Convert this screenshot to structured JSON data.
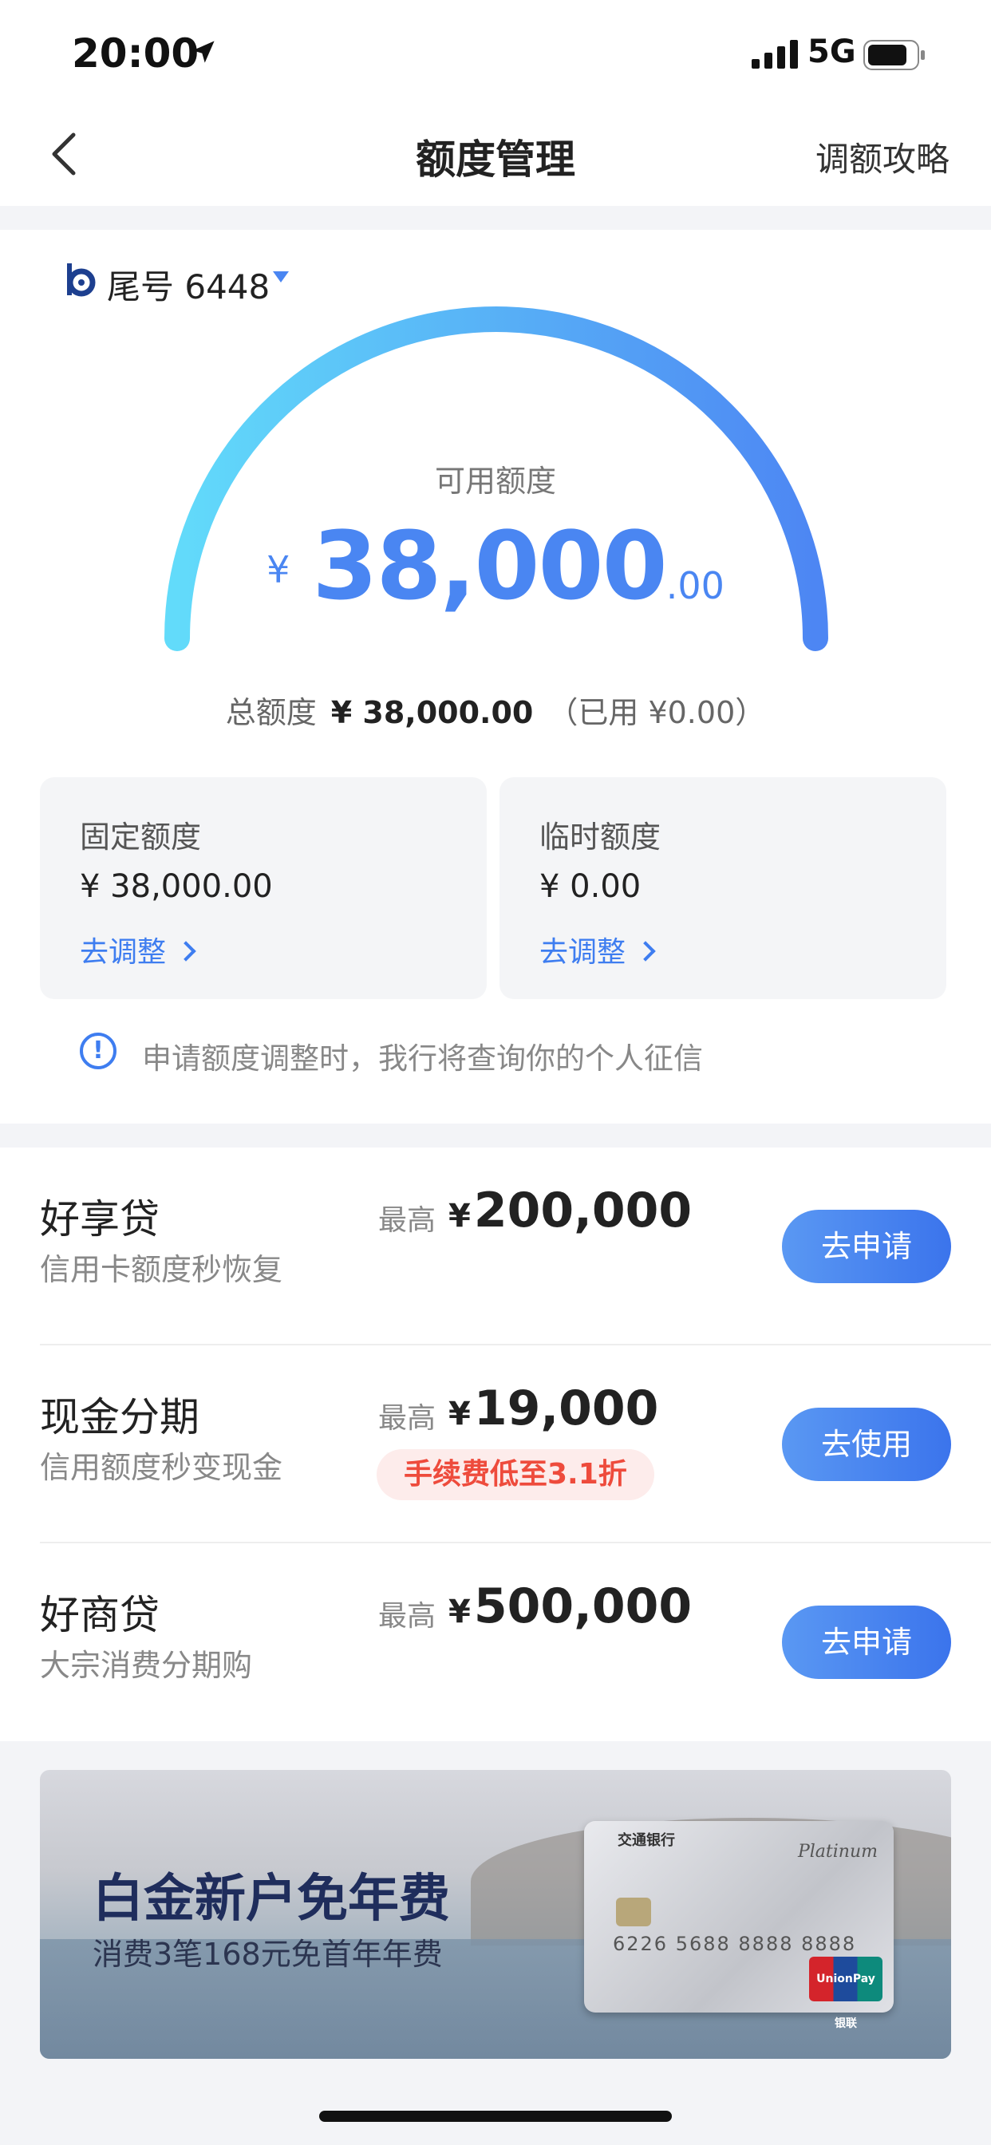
{
  "status_bar": {
    "time": "20:00",
    "network": "5G"
  },
  "nav": {
    "title": "额度管理",
    "right_link": "调额攻略"
  },
  "card": {
    "tail_label": "尾号 6448"
  },
  "credit": {
    "available_label": "可用额度",
    "currency": "¥",
    "available_integer": "38,000",
    "available_decimal": ".00",
    "total_label": "总额度",
    "total_value": "¥ 38,000.00",
    "used_text": "（已用 ¥0.00）"
  },
  "fixed_limit": {
    "label": "固定额度",
    "value": "¥ 38,000.00",
    "link": "去调整"
  },
  "temp_limit": {
    "label": "临时额度",
    "value": "¥ 0.00",
    "link": "去调整"
  },
  "notice": {
    "text": "申请额度调整时，我行将查询你的个人征信"
  },
  "loans": [
    {
      "title": "好享贷",
      "subtitle": "信用卡额度秒恢复",
      "max_label": "最高",
      "currency": "¥",
      "amount": "200,000",
      "tag": "",
      "button": "去申请"
    },
    {
      "title": "现金分期",
      "subtitle": "信用额度秒变现金",
      "max_label": "最高",
      "currency": "¥",
      "amount": "19,000",
      "tag": "手续费低至3.1折",
      "button": "去使用"
    },
    {
      "title": "好商贷",
      "subtitle": "大宗消费分期购",
      "max_label": "最高",
      "currency": "¥",
      "amount": "500,000",
      "tag": "",
      "button": "去申请"
    }
  ],
  "banner": {
    "title": "白金新户免年费",
    "subtitle": "消费3笔168元免首年年费",
    "card_bank": "交通银行",
    "card_tier": "Platinum",
    "card_number": "6226 5688 8888 8888",
    "card_network": "UnionPay 银联"
  },
  "colors": {
    "accent": "#3e7df0",
    "gauge_start": "#5fd6f8",
    "gauge_end": "#4a86f2",
    "tag_red": "#ee4b3c"
  }
}
